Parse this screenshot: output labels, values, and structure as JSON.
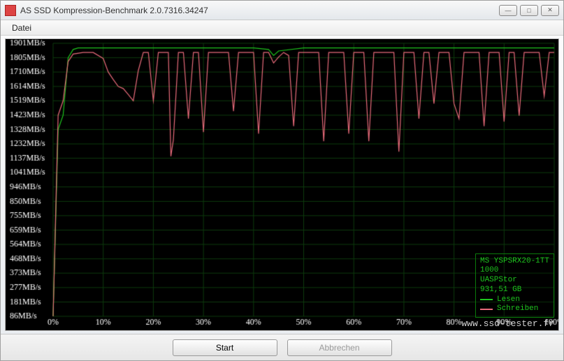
{
  "window": {
    "title": "AS SSD Kompression-Benchmark 2.0.7316.34247"
  },
  "menu": {
    "datei": "Datei"
  },
  "footer": {
    "start_label": "Start",
    "abort_label": "Abbrechen"
  },
  "legend": {
    "device_line1": "MS YSPSRX20-1TT",
    "device_line2": "1000",
    "device_line3": "UASPStor",
    "device_line4": "931,51 GB",
    "read_label": "Lesen",
    "write_label": "Schreiben",
    "read_color": "#1ec41e",
    "write_color": "#e86b7a"
  },
  "watermark": "www.ssd-tester.fr",
  "chart_data": {
    "type": "line",
    "xlabel": "",
    "ylabel": "",
    "x_unit": "%",
    "y_unit": "MB/s",
    "xlim": [
      0,
      100
    ],
    "ylim": [
      86,
      1901
    ],
    "y_ticks": [
      86,
      181,
      277,
      373,
      468,
      564,
      659,
      755,
      850,
      946,
      1041,
      1137,
      1232,
      1328,
      1423,
      1519,
      1614,
      1710,
      1805,
      1901
    ],
    "x_ticks": [
      0,
      10,
      20,
      30,
      40,
      50,
      60,
      70,
      80,
      90,
      100
    ],
    "series": [
      {
        "name": "Lesen",
        "color": "#1ec41e",
        "x": [
          0,
          1,
          2,
          3,
          4,
          5,
          10,
          15,
          20,
          25,
          30,
          35,
          40,
          43,
          44,
          45,
          50,
          55,
          60,
          65,
          70,
          75,
          80,
          85,
          90,
          95,
          100
        ],
        "y": [
          86,
          1328,
          1423,
          1805,
          1860,
          1870,
          1870,
          1870,
          1870,
          1870,
          1870,
          1870,
          1870,
          1860,
          1820,
          1850,
          1870,
          1870,
          1870,
          1870,
          1870,
          1870,
          1870,
          1870,
          1870,
          1870,
          1870
        ]
      },
      {
        "name": "Schreiben",
        "color": "#e86b7a",
        "x": [
          0,
          1,
          2,
          3,
          4,
          6,
          8,
          10,
          11,
          12,
          13,
          14,
          15,
          16,
          17,
          18,
          19,
          20,
          21,
          22,
          23,
          23.5,
          24,
          25,
          26,
          27,
          28,
          29,
          30,
          31,
          32,
          33,
          34,
          35,
          36,
          37,
          38,
          39,
          40,
          41,
          42,
          43,
          44,
          45,
          46,
          47,
          48,
          49,
          50,
          51,
          52,
          53,
          54,
          55,
          56,
          57,
          58,
          59,
          60,
          61,
          62,
          63,
          64,
          65,
          66,
          67,
          68,
          69,
          70,
          71,
          72,
          73,
          74,
          75,
          76,
          77,
          78,
          79,
          80,
          81,
          82,
          83,
          84,
          85,
          86,
          87,
          88,
          89,
          90,
          91,
          92,
          93,
          94,
          95,
          96,
          97,
          98,
          99,
          100
        ],
        "y": [
          86,
          1423,
          1519,
          1780,
          1830,
          1840,
          1840,
          1800,
          1710,
          1660,
          1614,
          1600,
          1560,
          1519,
          1720,
          1840,
          1840,
          1519,
          1840,
          1840,
          1840,
          1150,
          1260,
          1840,
          1840,
          1400,
          1840,
          1840,
          1310,
          1840,
          1840,
          1840,
          1840,
          1840,
          1450,
          1840,
          1840,
          1840,
          1840,
          1300,
          1840,
          1840,
          1770,
          1810,
          1840,
          1820,
          1350,
          1840,
          1840,
          1840,
          1840,
          1840,
          1250,
          1840,
          1840,
          1840,
          1840,
          1300,
          1840,
          1840,
          1840,
          1250,
          1840,
          1840,
          1840,
          1840,
          1840,
          1180,
          1840,
          1840,
          1840,
          1400,
          1840,
          1840,
          1500,
          1840,
          1840,
          1840,
          1500,
          1400,
          1840,
          1840,
          1840,
          1840,
          1350,
          1840,
          1840,
          1840,
          1380,
          1840,
          1840,
          1420,
          1840,
          1840,
          1840,
          1840,
          1550,
          1840,
          1840
        ]
      }
    ]
  }
}
